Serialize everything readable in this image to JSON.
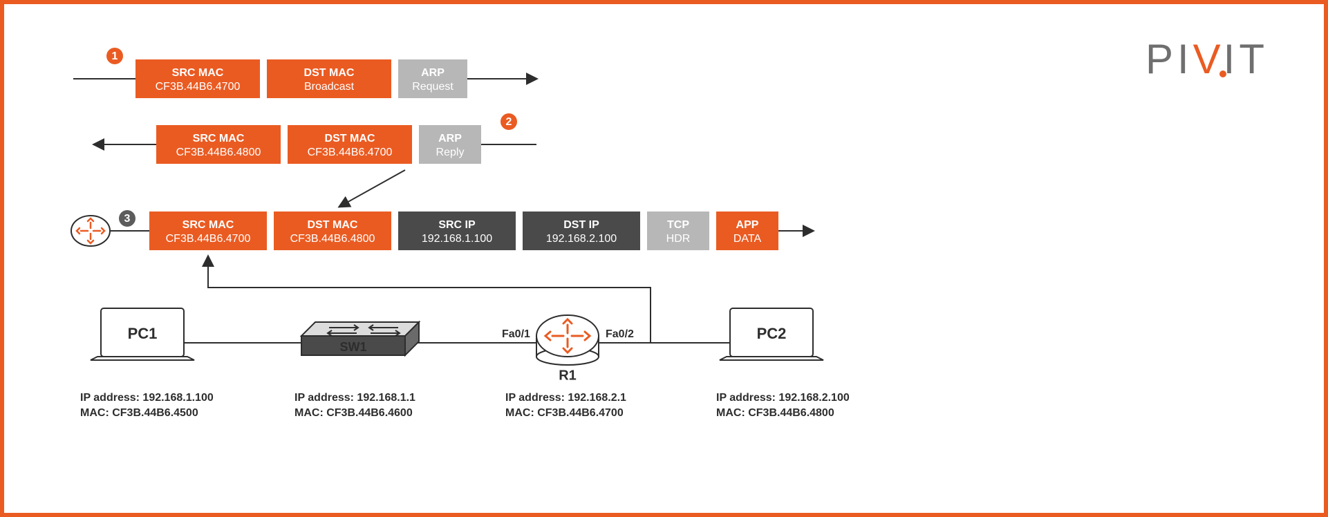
{
  "brand": {
    "text": "PIVIT",
    "accent_letter": "V"
  },
  "colors": {
    "orange": "#ea5b22",
    "dark_gray": "#4a4a4a",
    "light_gray": "#b7b7b7",
    "stroke": "#2d2d2d"
  },
  "steps": {
    "s1": "1",
    "s2": "2",
    "s3": "3"
  },
  "packet1": {
    "direction": "right",
    "src_mac_title": "SRC MAC",
    "src_mac_value": "CF3B.44B6.4700",
    "dst_mac_title": "DST MAC",
    "dst_mac_value": "Broadcast",
    "tail_title": "ARP",
    "tail_value": "Request"
  },
  "packet2": {
    "direction": "left",
    "src_mac_title": "SRC MAC",
    "src_mac_value": "CF3B.44B6.4800",
    "dst_mac_title": "DST MAC",
    "dst_mac_value": "CF3B.44B6.4700",
    "tail_title": "ARP",
    "tail_value": "Reply"
  },
  "packet3": {
    "direction": "right",
    "src_mac_title": "SRC MAC",
    "src_mac_value": "CF3B.44B6.4700",
    "dst_mac_title": "DST MAC",
    "dst_mac_value": "CF3B.44B6.4800",
    "src_ip_title": "SRC IP",
    "src_ip_value": "192.168.1.100",
    "dst_ip_title": "DST IP",
    "dst_ip_value": "192.168.2.100",
    "tcp_title": "TCP",
    "tcp_value": "HDR",
    "app_title": "APP",
    "app_value": "DATA"
  },
  "interfaces": {
    "left": "Fa0/1",
    "right": "Fa0/2"
  },
  "devices": {
    "pc1": {
      "name": "PC1",
      "ip_label": "IP address: 192.168.1.100",
      "mac_label": "MAC: CF3B.44B6.4500"
    },
    "sw1": {
      "name": "SW1",
      "ip_label": "IP address: 192.168.1.1",
      "mac_label": "MAC: CF3B.44B6.4600"
    },
    "r1": {
      "name": "R1",
      "ip_label": "IP address: 192.168.2.1",
      "mac_label": "MAC: CF3B.44B6.4700"
    },
    "pc2": {
      "name": "PC2",
      "ip_label": "IP address: 192.168.2.100",
      "mac_label": "MAC: CF3B.44B6.4800"
    }
  }
}
